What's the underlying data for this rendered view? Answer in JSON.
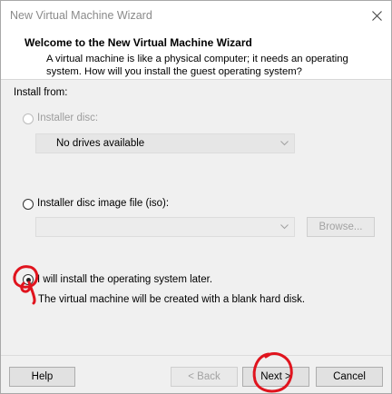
{
  "window": {
    "title": "New Virtual Machine Wizard"
  },
  "header": {
    "title": "Welcome to the New Virtual Machine Wizard",
    "description": "A virtual machine is like a physical computer; it needs an operating system. How will you install the guest operating system?"
  },
  "install_from": {
    "label": "Install from:",
    "options": [
      {
        "label": "Installer disc:",
        "selected": false,
        "enabled": false
      },
      {
        "label": "Installer disc image file (iso):",
        "selected": false,
        "enabled": true
      },
      {
        "label": "I will install the operating system later.",
        "selected": true,
        "enabled": true
      }
    ],
    "disc_dropdown_value": "No drives available",
    "iso_dropdown_value": "",
    "browse_label": "Browse...",
    "later_note": "The virtual machine will be created with a blank hard disk."
  },
  "footer": {
    "help_label": "Help",
    "back_label": "< Back",
    "next_label": "Next >",
    "cancel_label": "Cancel"
  },
  "annotation": {
    "handwritten_mark": "9",
    "color": "#e0141e"
  }
}
